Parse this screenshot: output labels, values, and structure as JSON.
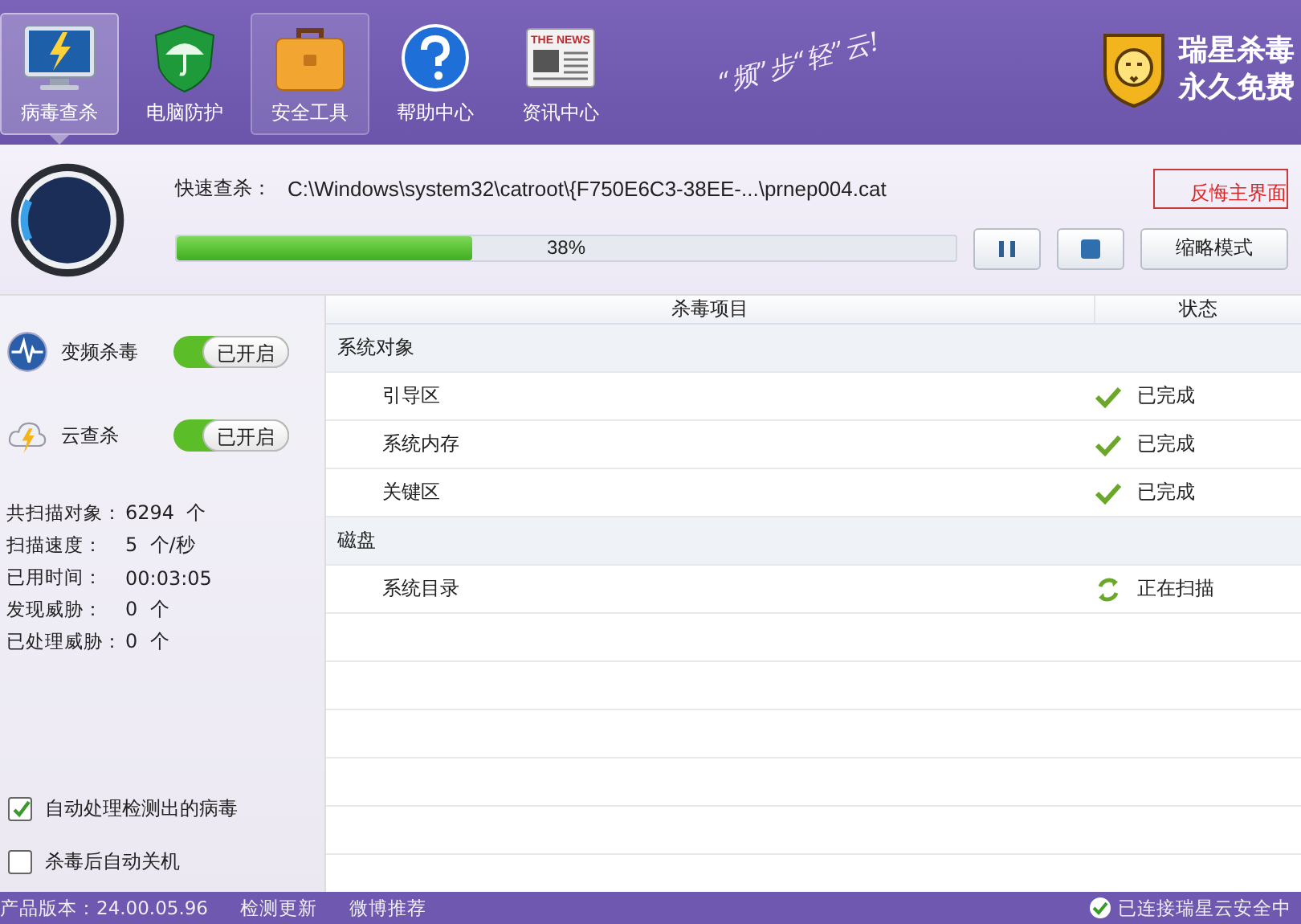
{
  "nav": [
    {
      "kind": "monitor",
      "label": "病毒查杀",
      "selected": true,
      "hovered": false
    },
    {
      "kind": "shield",
      "label": "电脑防护",
      "selected": false,
      "hovered": false
    },
    {
      "kind": "toolbox",
      "label": "安全工具",
      "selected": false,
      "hovered": true
    },
    {
      "kind": "help",
      "label": "帮助中心",
      "selected": false,
      "hovered": false
    },
    {
      "kind": "news",
      "label": "资讯中心",
      "selected": false,
      "hovered": false,
      "icon_caption": "THE NEWS"
    }
  ],
  "slogan": "“频”步“轻”云!",
  "brand": {
    "line1": "瑞星杀毒",
    "line2": "永久免费"
  },
  "scan": {
    "label": "快速查杀：",
    "path": "C:\\Windows\\system32\\catroot\\{F750E6C3-38EE-...\\prnep004.cat",
    "level": 0.38,
    "percent": "38%",
    "compact_button": "缩略模式",
    "back_link": "反悔主界面"
  },
  "toggles": [
    {
      "kind": "wave",
      "label": "变频杀毒",
      "on": true,
      "state_text": "已开启"
    },
    {
      "kind": "cloud",
      "label": "云查杀",
      "on": true,
      "state_text": "已开启"
    }
  ],
  "stats": [
    {
      "label": "共扫描对象：",
      "value": "6294  个"
    },
    {
      "label": "扫描速度：",
      "value": "5  个/秒"
    },
    {
      "label": "已用时间：",
      "value": "00:03:05"
    },
    {
      "label": "发现威胁：",
      "value": "0  个"
    },
    {
      "label": "已处理威胁：",
      "value": "0  个"
    }
  ],
  "options": [
    {
      "label": "自动处理检测出的病毒",
      "checked": true
    },
    {
      "label": "杀毒后自动关机",
      "checked": false
    }
  ],
  "table": {
    "columns": [
      "杀毒项目",
      "状态"
    ],
    "rows": [
      {
        "kind": "group",
        "name": "系统对象"
      },
      {
        "kind": "item",
        "name": "引导区",
        "completed": true,
        "status_text": "已完成"
      },
      {
        "kind": "item",
        "name": "系统内存",
        "completed": true,
        "status_text": "已完成"
      },
      {
        "kind": "item",
        "name": "关键区",
        "completed": true,
        "status_text": "已完成"
      },
      {
        "kind": "group",
        "name": "磁盘"
      },
      {
        "kind": "item",
        "name": "系统目录",
        "completed": false,
        "status_text": "正在扫描"
      }
    ]
  },
  "status_bar": {
    "version": "产品版本：24.00.05.96",
    "links": [
      "检测更新",
      "微博推荐"
    ],
    "connection": "已连接瑞星云安全中"
  }
}
